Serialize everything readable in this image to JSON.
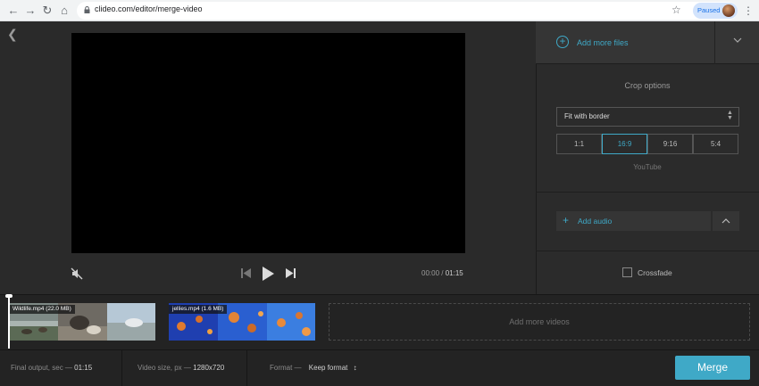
{
  "browser": {
    "url": "clideo.com/editor/merge-video",
    "profile_status": "Paused",
    "icons": [
      "back-arrow-icon",
      "forward-arrow-icon",
      "reload-icon",
      "home-icon",
      "lock-icon",
      "star-icon",
      "avatar",
      "more-vert-icon"
    ]
  },
  "player": {
    "time_current": "00:00",
    "time_separator": "/",
    "time_total": "01:15"
  },
  "panel": {
    "add_more_files": "Add more files",
    "crop_title": "Crop options",
    "crop_mode": "Fit with border",
    "ratios": [
      "1:1",
      "16:9",
      "9:16",
      "5:4"
    ],
    "selected_ratio": "16:9",
    "ratio_caption": "YouTube",
    "add_audio": "Add audio",
    "crossfade": "Crossfade",
    "crossfade_checked": false
  },
  "timeline": {
    "clips": [
      {
        "label": "Wildlife.mp4 (22.0 MB)"
      },
      {
        "label": "jellies.mp4 (1.6 MB)"
      }
    ],
    "add_more_videos": "Add more videos"
  },
  "bottom": {
    "final_output_label": "Final output, sec —",
    "final_output_value": "01:15",
    "video_size_label": "Video size, px —",
    "video_size_value": "1280x720",
    "format_label": "Format —",
    "format_value": "Keep format",
    "merge": "Merge"
  },
  "colors": {
    "accent": "#3fa9c7",
    "background": "#2a2a2a",
    "panel": "#2b2b2b"
  }
}
